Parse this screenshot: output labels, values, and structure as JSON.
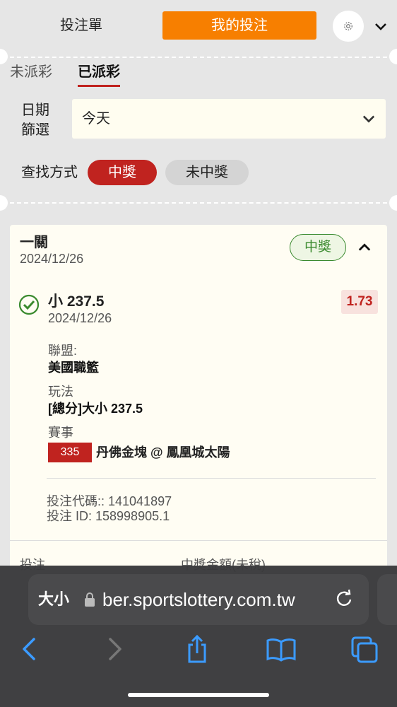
{
  "topbar": {
    "betslip_label": "投注單",
    "mybets_label": "我的投注"
  },
  "subtabs": {
    "unsettled": "未派彩",
    "settled": "已派彩"
  },
  "filters": {
    "date_label": "日期\n篩選",
    "date_value": "今天",
    "search_label": "查找方式",
    "win_label": "中獎",
    "lose_label": "未中獎"
  },
  "bet": {
    "type": "一關",
    "date": "2024/12/26",
    "status": "中獎",
    "selection": "小 237.5",
    "selection_date": "2024/12/26",
    "odds": "1.73",
    "league_label": "聯盟:",
    "league": "美國職籃",
    "market_label": "玩法",
    "market": "[總分]大小 237.5",
    "event_label": "賽事",
    "event_number": "335",
    "event_name": "丹佛金塊 @ 鳳凰城太陽",
    "bet_code": "投注代碼:: 141041897",
    "bet_id": "投注 ID: 158998905.1",
    "stake_label": "投注",
    "payout_label": "中獎金額(未稅)"
  },
  "browser": {
    "text_size": "大小",
    "url": "ber.sportslottery.com.tw"
  },
  "colors": {
    "accent": "#f77f00",
    "win_red": "#c0231f",
    "win_green": "#3a8a2e"
  }
}
